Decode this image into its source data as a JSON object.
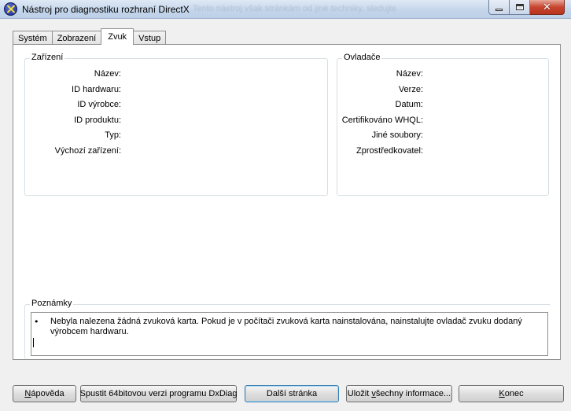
{
  "window": {
    "title": "Nástroj pro diagnostiku rozhraní DirectX",
    "ghost_title": "Tento nástroj však stránkám od jiné techniky, sledujte"
  },
  "tabs": [
    {
      "label": "Systém"
    },
    {
      "label": "Zobrazení"
    },
    {
      "label": "Zvuk"
    },
    {
      "label": "Vstup"
    }
  ],
  "active_tab": "Zvuk",
  "device_group": {
    "title": "Zařízení",
    "fields": [
      "Název:",
      "ID hardwaru:",
      "ID výrobce:",
      "ID produktu:",
      "Typ:",
      "Výchozí zařízení:"
    ]
  },
  "driver_group": {
    "title": "Ovladače",
    "fields": [
      "Název:",
      "Verze:",
      "Datum:",
      "Certifikováno WHQL:",
      "Jiné soubory:",
      "Zprostředkovatel:"
    ]
  },
  "notes": {
    "title": "Poznámky",
    "bullet": "•",
    "line1": "Nebyla nalezena žádná zvuková karta. Pokud je v počítači zvuková karta nainstalována, nainstalujte ovladač zvuku dodaný",
    "line2": "výrobcem hardwaru."
  },
  "buttons": {
    "help": {
      "mnemonic": "N",
      "rest": "ápověda"
    },
    "run64": "Spustit 64bitovou verzi programu DxDiag",
    "next_page": "Další stránka",
    "save_all": {
      "pre": "Uložit ",
      "mnemonic": "v",
      "rest": "šechny informace..."
    },
    "exit": {
      "mnemonic": "K",
      "rest": "onec"
    }
  }
}
